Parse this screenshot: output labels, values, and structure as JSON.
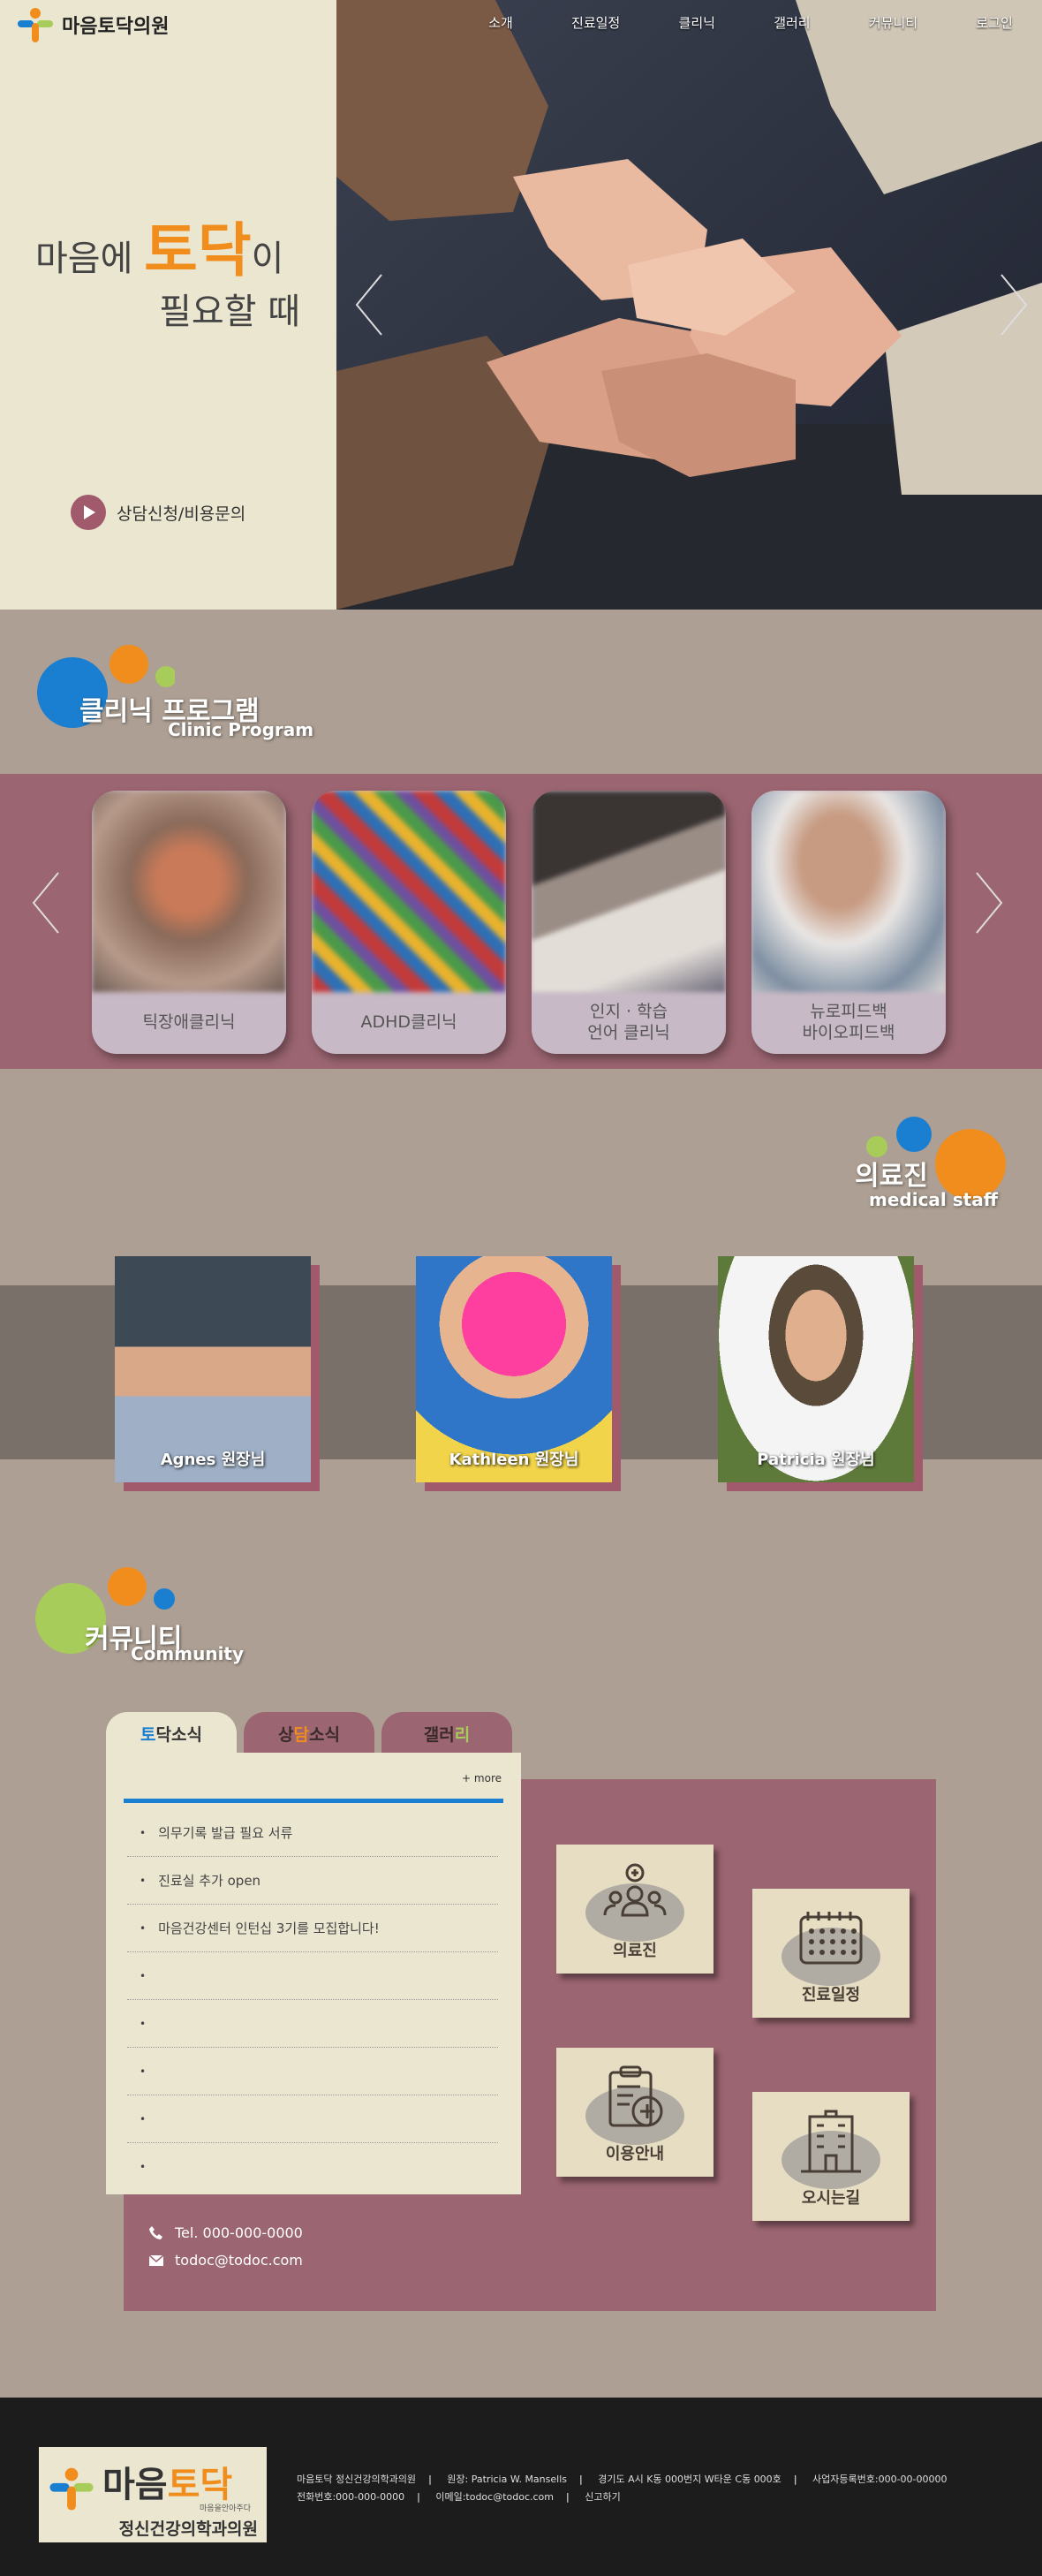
{
  "brand": {
    "name": "마음토닥의원"
  },
  "nav": {
    "items": [
      "소개",
      "진료일정",
      "클리닉",
      "갤러리",
      "커뮤니티",
      "로그인"
    ]
  },
  "hero": {
    "line1_pre": "마음에 ",
    "line1_em": "토닥",
    "line1_post": "이",
    "line2": "필요할 때",
    "cta": "상담신청/비용문의"
  },
  "clinic": {
    "title_ko": "클리닉 프로그램",
    "title_en": "Clinic Program",
    "cards": [
      {
        "label": "틱장애클리닉"
      },
      {
        "label": "ADHD클리닉"
      },
      {
        "label": "인지 · 학습\n언어 클리닉"
      },
      {
        "label": "뉴로피드백\n바이오피드백"
      }
    ]
  },
  "staff": {
    "title_ko": "의료진",
    "title_en": "medical staff",
    "members": [
      {
        "name": "Agnes 원장님"
      },
      {
        "name": "Kathleen 원장님"
      },
      {
        "name": "Patricia 원장님"
      }
    ]
  },
  "community": {
    "title_ko": "커뮤니티",
    "title_en": "Community",
    "tabs": [
      {
        "a": "토",
        "b": "닥소식"
      },
      {
        "a": "상",
        "b": "담",
        "c": "소식"
      },
      {
        "a": "갤러",
        "b": "리"
      }
    ],
    "more": "+ more",
    "notices": [
      "의무기록 발급 필요 서류",
      "진료실 추가 open",
      "마음건강센터 인턴십 3기를 모집합니다!",
      "",
      "",
      "",
      "",
      ""
    ],
    "quick": [
      {
        "label": "의료진"
      },
      {
        "label": "진료일정"
      },
      {
        "label": "이용안내"
      },
      {
        "label": "오시는길"
      }
    ],
    "tel": "Tel. 000-000-0000",
    "email": "todoc@todoc.com"
  },
  "footer": {
    "logo_main_a": "마음",
    "logo_main_b": "토닥",
    "logo_small": "마음을안아주다",
    "logo_sub": "정신건강의학과의원",
    "line1": [
      "마음토닥 정신건강의학과의원",
      "원장: Patricia W. Mansells",
      "경기도 A시 K동 000번지 W타운 C동 000호",
      "사업자등록번호:000-00-00000"
    ],
    "line2": [
      "전화번호:000-000-0000",
      "이메일:todoc@todoc.com",
      "신고하기"
    ]
  },
  "colors": {
    "accent": "#f08d1d",
    "plum": "#9b6571",
    "cream": "#ebe6d0",
    "blue": "#1a7fd0",
    "green": "#a8cc5a"
  }
}
